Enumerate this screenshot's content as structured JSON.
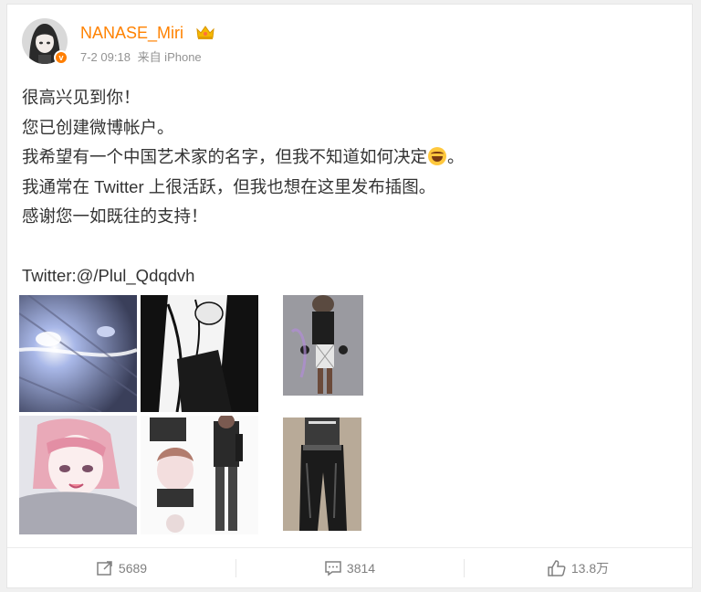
{
  "post": {
    "username": "NANASE_Miri",
    "timestamp": "7-2 09:18",
    "source": "来自 iPhone",
    "text_lines": [
      "很高兴见到你！",
      "您已创建微博帐户。",
      "我希望有一个中国艺术家的名字，但我不知道如何决定",
      "。",
      "我通常在 Twitter 上很活跃，但我也想在这里发布插图。",
      "感谢您一如既往的支持！",
      "Twitter:@/Plul_Qdqdvh"
    ],
    "emoji": "laugh-cry-emoji"
  },
  "images": [
    {
      "name": "image-1",
      "icon": "glowing-face-artwork"
    },
    {
      "name": "image-2",
      "icon": "monochrome-hands-artwork"
    },
    {
      "name": "image-3",
      "icon": "outfit-figure-artwork"
    },
    {
      "name": "image-4",
      "icon": "pink-hair-girl-artwork"
    },
    {
      "name": "image-5",
      "icon": "character-sheet-artwork"
    },
    {
      "name": "image-6",
      "icon": "leather-outfit-artwork"
    }
  ],
  "actions": {
    "repost_count": "5689",
    "comment_count": "3814",
    "like_count": "13.8万"
  },
  "colors": {
    "username": "#ff8200",
    "meta": "#939393",
    "text": "#333333",
    "action": "#808080"
  }
}
